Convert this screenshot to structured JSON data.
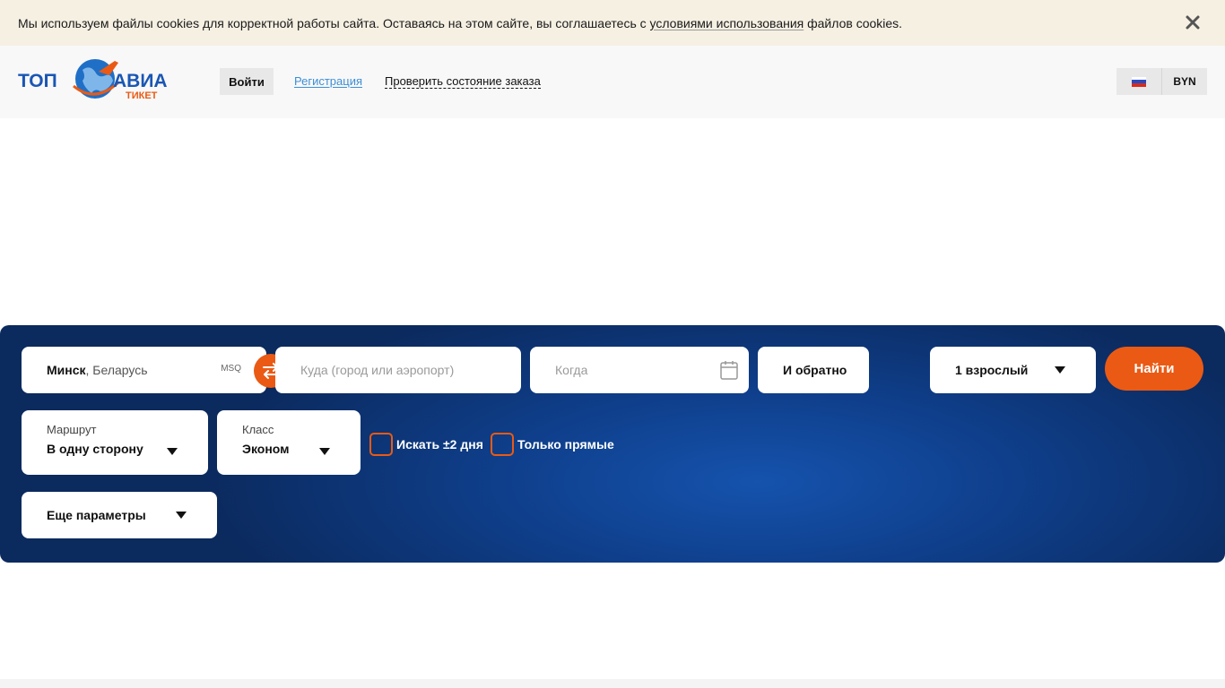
{
  "cookie": {
    "text_before": "Мы используем файлы cookies для корректной работы сайта. Оставаясь на этом сайте, вы соглашаетесь с ",
    "link_text": "условиями использования",
    "text_after": " файлов cookies."
  },
  "header": {
    "logo": {
      "top": "ТОП",
      "main": "АВИА",
      "sub": "ТИКЕТ"
    },
    "login_label": "Войти",
    "register_label": "Регистрация",
    "check_order_label": "Проверить состояние заказа",
    "language": "ru",
    "currency": "BYN"
  },
  "search": {
    "from": {
      "city": "Минск",
      "country": ", Беларусь",
      "code": "MSQ"
    },
    "to_placeholder": "Куда (город или аэропорт)",
    "date_placeholder": "Когда",
    "return_label": "И обратно",
    "passengers": "1 взрослый",
    "find_label": "Найти",
    "route": {
      "label": "Маршрут",
      "value": "В одну сторону"
    },
    "cabin": {
      "label": "Класс",
      "value": "Эконом"
    },
    "flex_dates_label": "Искать ±2 дня",
    "direct_only_label": "Только прямые",
    "more_params_label": "Еще параметры"
  },
  "colors": {
    "accent": "#ea5a14",
    "panel_dark": "#0b2a5e",
    "panel_light": "#1553ad",
    "link": "#3d8fd6",
    "cookie_bg": "#f6f0e3"
  }
}
